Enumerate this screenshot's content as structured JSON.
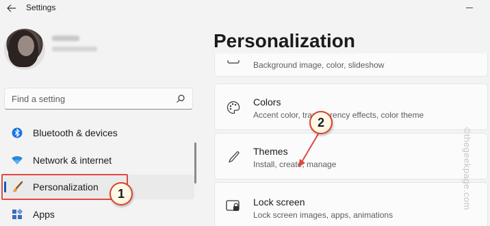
{
  "window": {
    "title": "Settings"
  },
  "profile": {
    "name": "",
    "email": ""
  },
  "search": {
    "placeholder": "Find a setting"
  },
  "nav": {
    "items": [
      {
        "label": "Bluetooth & devices",
        "icon": "bluetooth-icon"
      },
      {
        "label": "Network & internet",
        "icon": "wifi-icon"
      },
      {
        "label": "Personalization",
        "icon": "brush-icon",
        "selected": true
      },
      {
        "label": "Apps",
        "icon": "apps-icon"
      }
    ]
  },
  "main": {
    "title": "Personalization",
    "cards": [
      {
        "title": "",
        "subtitle": "Background image, color, slideshow",
        "icon": "background-icon"
      },
      {
        "title": "Colors",
        "subtitle": "Accent color, transparency effects, color theme",
        "icon": "palette-icon"
      },
      {
        "title": "Themes",
        "subtitle": "Install, create, manage",
        "icon": "pen-icon"
      },
      {
        "title": "Lock screen",
        "subtitle": "Lock screen images, apps, animations",
        "icon": "lock-screen-icon"
      }
    ]
  },
  "annotations": {
    "step1": "1",
    "step2": "2"
  },
  "watermark": "©thegeekpage.com",
  "colors": {
    "accent": "#005fb8",
    "annotation_red": "#e0473f"
  }
}
